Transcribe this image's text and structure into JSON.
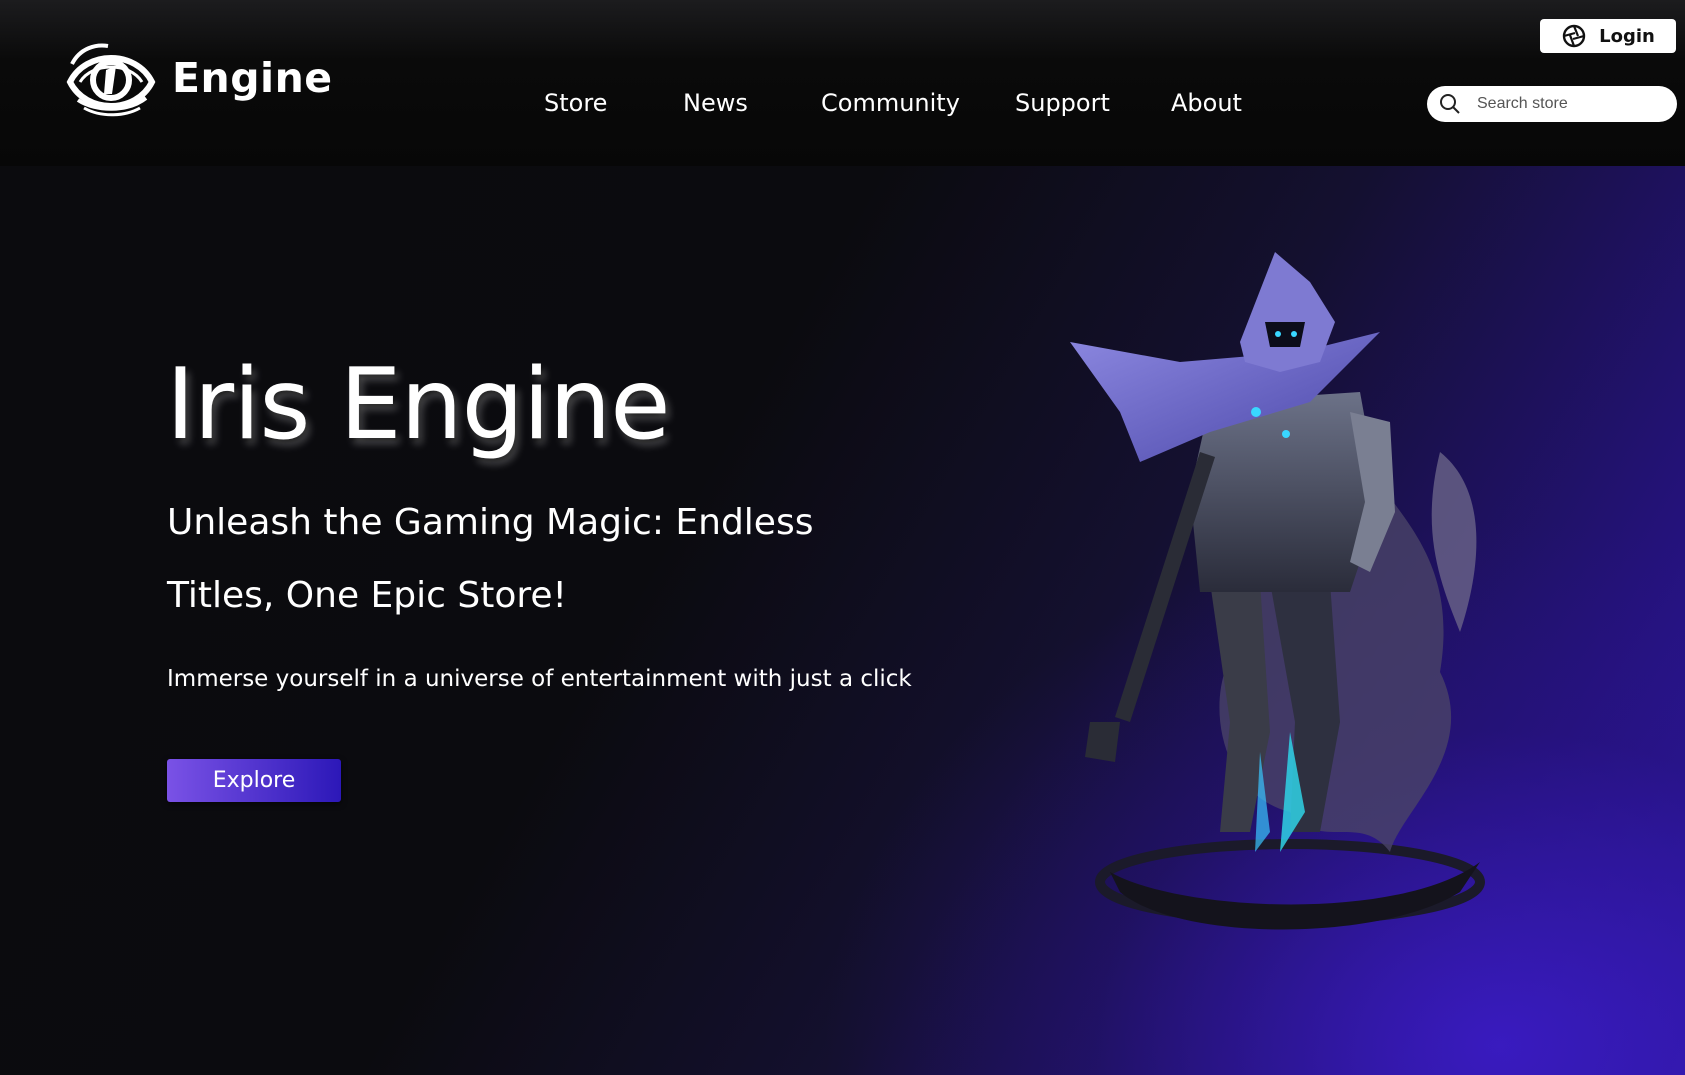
{
  "brand": {
    "name": "Engine",
    "logo_icon": "eye-logo-icon"
  },
  "nav": {
    "items": [
      {
        "label": "Store"
      },
      {
        "label": "News"
      },
      {
        "label": "Community"
      },
      {
        "label": "Support"
      },
      {
        "label": "About"
      }
    ]
  },
  "login": {
    "label": "Login",
    "icon": "aperture-icon"
  },
  "search": {
    "placeholder": "Search store",
    "value": "",
    "icon": "search-icon"
  },
  "hero": {
    "title": "Iris Engine",
    "subtitle": "Unleash the Gaming Magic: Endless Titles, One Epic Store!",
    "description": "Immerse yourself in a universe of entertainment with just a click",
    "cta_label": "Explore",
    "image": "hooded-warrior-character-illustration"
  },
  "colors": {
    "accent_start": "#7a52e6",
    "accent_end": "#2c18b8",
    "header_bg": "#0a0a0a",
    "hero_glow": "#2e18a8"
  }
}
